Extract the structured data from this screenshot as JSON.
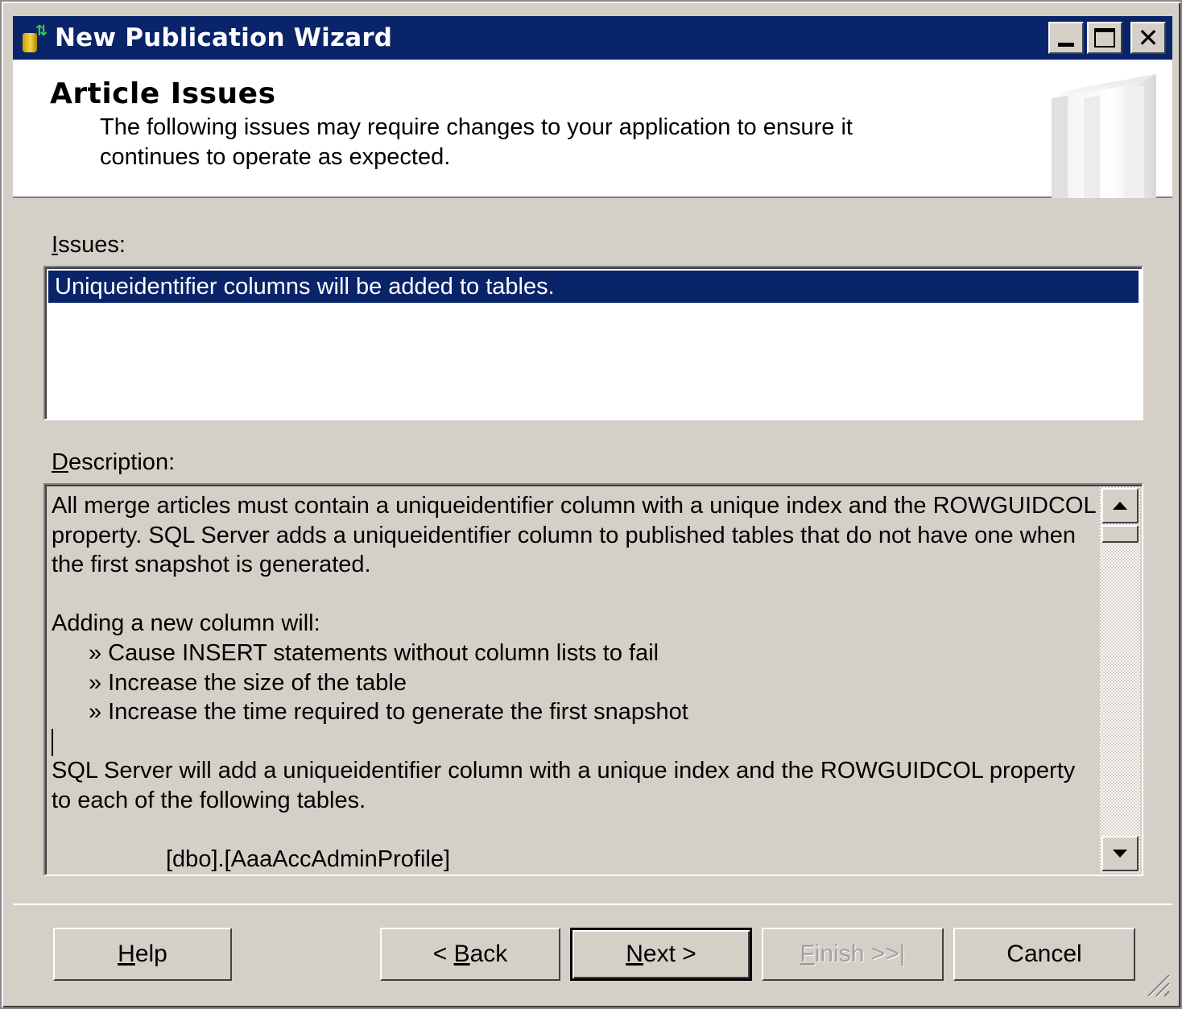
{
  "window": {
    "title": "New Publication Wizard",
    "controls": [
      "minimize",
      "maximize",
      "close"
    ]
  },
  "header": {
    "title": "Article Issues",
    "description": "The following issues may require changes to your application to ensure it continues to operate as expected."
  },
  "issues": {
    "label_accel": "I",
    "label_rest": "ssues:",
    "items": [
      {
        "text": "Uniqueidentifier columns will be added to tables.",
        "selected": true
      }
    ]
  },
  "description": {
    "label_accel": "D",
    "label_rest": "escription:",
    "paragraph1": "All merge articles must contain a uniqueidentifier column with a unique index and the ROWGUIDCOL property. SQL Server adds a uniqueidentifier column to published tables that do not have one when the first snapshot is generated.",
    "intro2": "Adding a new column will:",
    "bullets": [
      "» Cause INSERT statements without column lists to fail",
      "» Increase the size of the table",
      "» Increase the time required to generate the first snapshot"
    ],
    "paragraph3": "SQL Server will add a uniqueidentifier column with a unique index and the ROWGUIDCOL property to each of the following tables.",
    "tables": [
      "[dbo].[AaaAccAdminProfile]"
    ]
  },
  "buttons": {
    "help": {
      "accel": "H",
      "rest": "elp"
    },
    "back": {
      "pre": "< ",
      "accel": "B",
      "rest": "ack"
    },
    "next": {
      "accel": "N",
      "rest": "ext >"
    },
    "finish": {
      "accel": "F",
      "rest": "inish >>|",
      "disabled": true
    },
    "cancel": {
      "label": "Cancel"
    }
  },
  "colors": {
    "titlebar": "#0a246a",
    "selection": "#0a246a",
    "face": "#d4d0c8"
  }
}
